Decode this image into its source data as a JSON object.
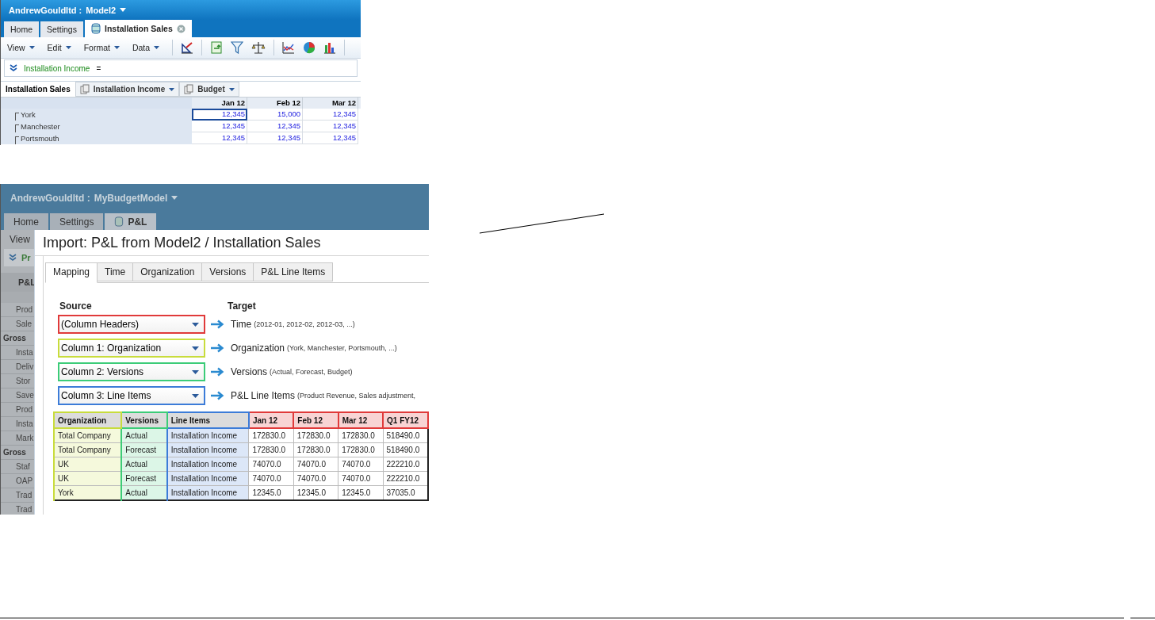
{
  "screenshot_1": {
    "header": {
      "account": "AndrewGouldltd :",
      "model": "Model2"
    },
    "tabs": [
      {
        "label": "Home",
        "kind": "plain",
        "selected": false
      },
      {
        "label": "Settings",
        "kind": "plain",
        "selected": false
      },
      {
        "label": "Installation Sales",
        "kind": "sheet",
        "selected": true
      }
    ],
    "menus": [
      "View",
      "Edit",
      "Format",
      "Data"
    ],
    "formula": {
      "member": "Installation Income",
      "operator": "="
    },
    "pivot": {
      "title": "Installation Sales",
      "dropdowns": [
        "Installation Income",
        "Budget"
      ]
    },
    "grid": {
      "columns": [
        "Jan 12",
        "Feb 12",
        "Mar 12"
      ],
      "rows": [
        {
          "label": "York",
          "cells": [
            {
              "value": "12,345",
              "selected": true
            },
            {
              "value": "15,000",
              "selected": false
            },
            {
              "value": "12,345",
              "selected": false
            }
          ]
        },
        {
          "label": "Manchester",
          "cells": [
            {
              "value": "12,345",
              "selected": false
            },
            {
              "value": "12,345",
              "selected": false
            },
            {
              "value": "12,345",
              "selected": false
            }
          ]
        },
        {
          "label": "Portsmouth",
          "cells": [
            {
              "value": "12,345",
              "selected": false
            },
            {
              "value": "12,345",
              "selected": false
            },
            {
              "value": "12,345",
              "selected": false
            }
          ]
        }
      ]
    }
  },
  "screenshot_2": {
    "header": {
      "account": "AndrewGouldltd :",
      "model": "MyBudgetModel"
    },
    "tabs": [
      {
        "label": "Home",
        "kind": "plain",
        "selected": false
      },
      {
        "label": "Settings",
        "kind": "plain",
        "selected": false
      },
      {
        "label": "P&L",
        "kind": "sheet",
        "selected": true
      }
    ],
    "menu": "View",
    "formula_member": "Pr",
    "sidebar": {
      "heading": "P&L",
      "rows": [
        {
          "label": "Prod",
          "kind": "item"
        },
        {
          "label": "Sale",
          "kind": "item"
        },
        {
          "label": "Gross",
          "kind": "group"
        },
        {
          "label": "Insta",
          "kind": "item"
        },
        {
          "label": "Deliv",
          "kind": "item"
        },
        {
          "label": "Stor",
          "kind": "item"
        },
        {
          "label": "Save",
          "kind": "item"
        },
        {
          "label": "Prod",
          "kind": "item"
        },
        {
          "label": "Insta",
          "kind": "item"
        },
        {
          "label": "Mark",
          "kind": "item"
        },
        {
          "label": "Gross",
          "kind": "group"
        },
        {
          "label": "Staf",
          "kind": "item"
        },
        {
          "label": "OAP",
          "kind": "item"
        },
        {
          "label": "Trad",
          "kind": "item"
        },
        {
          "label": "Trad",
          "kind": "item"
        }
      ]
    },
    "dialog": {
      "title": "Import: P&L from Model2 / Installation Sales",
      "tabs": [
        {
          "label": "Mapping",
          "selected": true
        },
        {
          "label": "Time",
          "selected": false
        },
        {
          "label": "Organization",
          "selected": false
        },
        {
          "label": "Versions",
          "selected": false
        },
        {
          "label": "P&L Line Items",
          "selected": false
        }
      ],
      "source_heading": "Source",
      "target_heading": "Target",
      "mappings": [
        {
          "source": "(Column Headers)",
          "color": "#e03a3a",
          "target": "Time",
          "detail": "(2012-01, 2012-02, 2012-03, ...)"
        },
        {
          "source": "Column 1: Organization",
          "color": "#c8dc3c",
          "target": "Organization",
          "detail": "(York, Manchester, Portsmouth, ...)"
        },
        {
          "source": "Column 2: Versions",
          "color": "#3ccc78",
          "target": "Versions",
          "detail": "(Actual, Forecast, Budget)"
        },
        {
          "source": "Column 3: Line Items",
          "color": "#3c7cd8",
          "target": "P&L Line Items",
          "detail": "(Product Revenue, Sales adjustment,"
        }
      ],
      "preview": {
        "columns": [
          {
            "label": "Organization",
            "color": "#c8dc3c"
          },
          {
            "label": "Versions",
            "color": "#3ccc78"
          },
          {
            "label": "Line Items",
            "color": "#3c7cd8"
          },
          {
            "label": "Jan 12",
            "color": "#e03a3a"
          },
          {
            "label": "Feb 12",
            "color": "#e03a3a"
          },
          {
            "label": "Mar 12",
            "color": "#e03a3a"
          },
          {
            "label": "Q1 FY12",
            "color": "#e03a3a"
          }
        ],
        "rows": [
          [
            "Total Company",
            "Actual",
            "Installation Income",
            "172830.0",
            "172830.0",
            "172830.0",
            "518490.0"
          ],
          [
            "Total Company",
            "Forecast",
            "Installation Income",
            "172830.0",
            "172830.0",
            "172830.0",
            "518490.0"
          ],
          [
            "UK",
            "Actual",
            "Installation Income",
            "74070.0",
            "74070.0",
            "74070.0",
            "222210.0"
          ],
          [
            "UK",
            "Forecast",
            "Installation Income",
            "74070.0",
            "74070.0",
            "74070.0",
            "222210.0"
          ],
          [
            "York",
            "Actual",
            "Installation Income",
            "12345.0",
            "12345.0",
            "12345.0",
            "37035.0"
          ]
        ]
      }
    }
  }
}
